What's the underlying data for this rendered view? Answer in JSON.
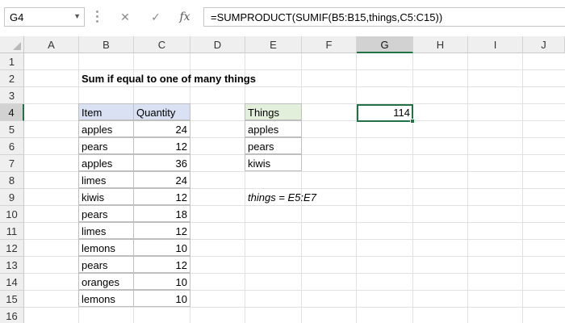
{
  "name_box": "G4",
  "formula": "=SUMPRODUCT(SUMIF(B5:B15,things,C5:C15))",
  "formula_buttons": {
    "cancel": "✕",
    "enter": "✓",
    "fx": "fx"
  },
  "columns": [
    "A",
    "B",
    "C",
    "D",
    "E",
    "F",
    "G",
    "H",
    "I",
    "J"
  ],
  "rows": [
    "1",
    "2",
    "3",
    "4",
    "5",
    "6",
    "7",
    "8",
    "9",
    "10",
    "11",
    "12",
    "13",
    "14",
    "15",
    "16"
  ],
  "title": "Sum if equal to one of many things",
  "table": {
    "headers": [
      "Item",
      "Quantity"
    ],
    "rows": [
      [
        "apples",
        "24"
      ],
      [
        "pears",
        "12"
      ],
      [
        "apples",
        "36"
      ],
      [
        "limes",
        "24"
      ],
      [
        "kiwis",
        "12"
      ],
      [
        "pears",
        "18"
      ],
      [
        "limes",
        "12"
      ],
      [
        "lemons",
        "10"
      ],
      [
        "pears",
        "12"
      ],
      [
        "oranges",
        "10"
      ],
      [
        "lemons",
        "10"
      ]
    ]
  },
  "things": {
    "header": "Things",
    "items": [
      "apples",
      "pears",
      "kiwis"
    ]
  },
  "named_range_note": "things = E5:E7",
  "result": "114",
  "colors": {
    "selection_green": "#217346",
    "item_header_fill": "#d9e1f2",
    "things_header_fill": "#e2efda"
  }
}
